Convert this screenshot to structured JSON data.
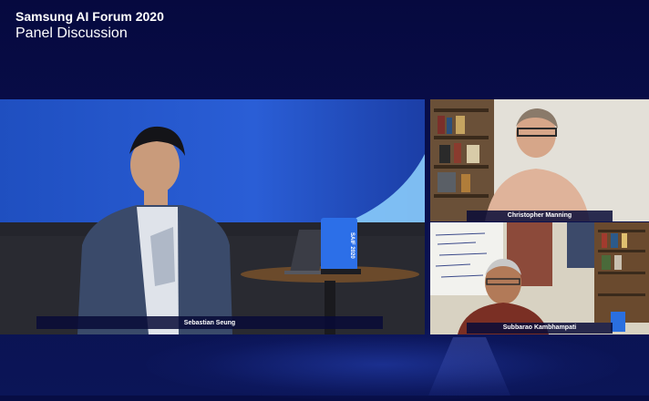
{
  "event": {
    "title": "Samsung AI Forum 2020",
    "subtitle": "Panel Discussion"
  },
  "participants": {
    "main": {
      "name": "Sebastian Seung"
    },
    "top_right": {
      "name": "Christopher Manning"
    },
    "bottom_right": {
      "name": "Subbarao Kambhampati"
    }
  },
  "stage_sign": {
    "text": "SAIF 2020"
  },
  "colors": {
    "background": "#070d44",
    "stage_blue": "#1f55c8",
    "name_bar": "#080a37"
  }
}
